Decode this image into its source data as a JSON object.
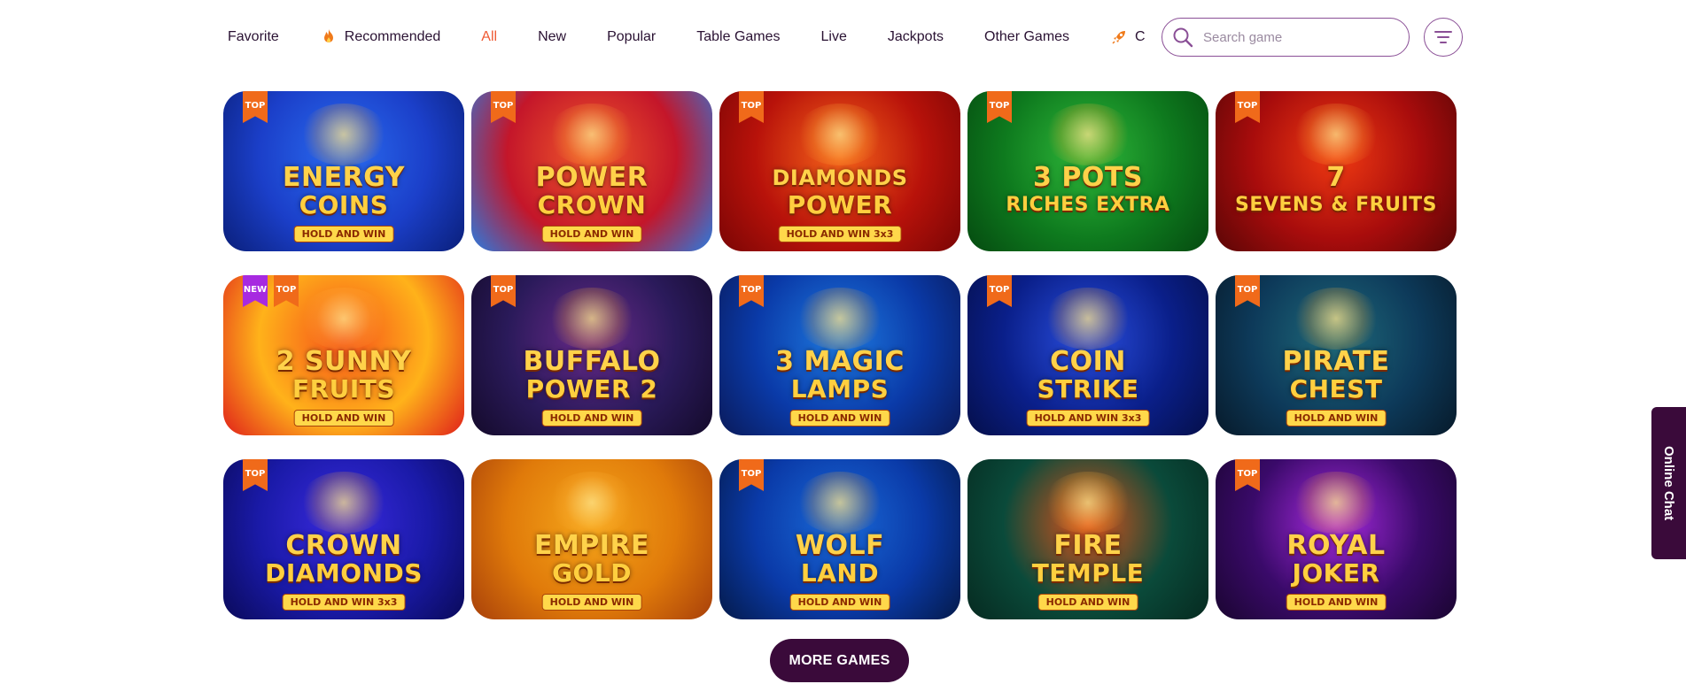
{
  "nav": {
    "items": [
      {
        "label": "Favorite",
        "icon": "",
        "active": false
      },
      {
        "label": "Recommended",
        "icon": "flame-icon",
        "active": false
      },
      {
        "label": "All",
        "icon": "",
        "active": true
      },
      {
        "label": "New",
        "icon": "",
        "active": false
      },
      {
        "label": "Popular",
        "icon": "",
        "active": false
      },
      {
        "label": "Table Games",
        "icon": "",
        "active": false
      },
      {
        "label": "Live",
        "icon": "",
        "active": false
      },
      {
        "label": "Jackpots",
        "icon": "",
        "active": false
      },
      {
        "label": "Other Games",
        "icon": "",
        "active": false
      },
      {
        "label": "Crash games",
        "icon": "rocket-icon",
        "active": false
      }
    ],
    "accent_color": "#ef5a33"
  },
  "search": {
    "placeholder": "Search game",
    "value": ""
  },
  "filter": {
    "icon": "filter-icon"
  },
  "games": [
    {
      "line1": "Energy",
      "line2": "Coins",
      "subtitle": "HOLD AND WIN",
      "badges": [
        "TOP"
      ]
    },
    {
      "line1": "Power",
      "line2": "Crown",
      "subtitle": "HOLD AND WIN",
      "badges": [
        "TOP"
      ]
    },
    {
      "line1": "Diamonds",
      "line2": "Power",
      "subtitle": "HOLD AND WIN 3x3",
      "badges": [
        "TOP"
      ]
    },
    {
      "line1": "3 Pots",
      "line2": "Riches Extra",
      "subtitle": "",
      "badges": [
        "TOP"
      ]
    },
    {
      "line1": "7",
      "line2": "Sevens & Fruits",
      "subtitle": "",
      "badges": [
        "TOP"
      ]
    },
    {
      "line1": "2 Sunny",
      "line2": "Fruits",
      "subtitle": "HOLD AND WIN",
      "badges": [
        "NEW",
        "TOP"
      ]
    },
    {
      "line1": "Buffalo",
      "line2": "Power 2",
      "subtitle": "HOLD AND WIN",
      "badges": [
        "TOP"
      ]
    },
    {
      "line1": "3 Magic",
      "line2": "Lamps",
      "subtitle": "HOLD AND WIN",
      "badges": [
        "TOP"
      ]
    },
    {
      "line1": "Coin",
      "line2": "Strike",
      "subtitle": "HOLD AND WIN 3x3",
      "badges": [
        "TOP"
      ]
    },
    {
      "line1": "Pirate",
      "line2": "Chest",
      "subtitle": "HOLD AND WIN",
      "badges": [
        "TOP"
      ]
    },
    {
      "line1": "Crown",
      "line2": "Diamonds",
      "subtitle": "HOLD AND WIN 3x3",
      "badges": [
        "TOP"
      ]
    },
    {
      "line1": "Empire",
      "line2": "Gold",
      "subtitle": "HOLD AND WIN",
      "badges": []
    },
    {
      "line1": "Wolf",
      "line2": "Land",
      "subtitle": "HOLD AND WIN",
      "badges": [
        "TOP"
      ]
    },
    {
      "line1": "Fire",
      "line2": "Temple",
      "subtitle": "HOLD AND WIN",
      "badges": []
    },
    {
      "line1": "Royal",
      "line2": "Joker",
      "subtitle": "HOLD AND WIN",
      "badges": [
        "TOP"
      ]
    }
  ],
  "more_button": {
    "label": "MORE GAMES"
  },
  "chat": {
    "label": "Online Chat"
  },
  "colors": {
    "primary_dark": "#3a0a3a",
    "badge_top": "#f06a1a",
    "badge_new": "#a72ae0"
  }
}
